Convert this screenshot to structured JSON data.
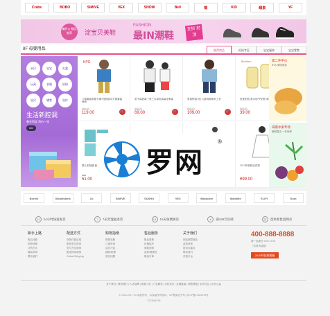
{
  "top_brands": [
    "Crabs",
    "BOBO",
    "SIMIVE",
    "VEX",
    "SHOW",
    "Bell",
    "帮",
    "KID",
    "晴泉",
    "YF"
  ],
  "banner": {
    "circle_text": "美的公\n精品推荐",
    "brand": "淀宝贝美鞋",
    "fashion": "FASHION",
    "main": "最IN潮鞋",
    "tag": "五折\n封顶"
  },
  "floor": {
    "title": "8F 母婴用品",
    "tabs": [
      "推荐商品",
      "妈妈专区",
      "宝宝服饰",
      "宝宝零食"
    ],
    "left_tags": [
      "米贝",
      "宝宝",
      "礼盒",
      "玩具",
      "衣服",
      "奶粉",
      "宝贝",
      "辅食",
      "洗护"
    ],
    "left_title": "生活新腔调",
    "left_sub": "春天特卖 特价一览",
    "left_btn": "GO",
    "products": [
      {
        "name": "儿童套装男童卡通T恤短袖中大童套装休闲",
        "old": "¥99.00",
        "price": "119.00"
      },
      {
        "name": "亲子装夏装一家三口母女装装全家装",
        "old": "¥99.00",
        "price": "69.00"
      },
      {
        "name": "男童短袖T恤 儿童纯棉休闲上衣",
        "old": "¥99.00",
        "price": "109.00"
      },
      {
        "name": "宝宝奶瓶 宽口径PP奶瓶 婴儿防胀气",
        "old": "¥99.00",
        "price": "39.00"
      },
      {
        "name": "婴儿奶粉罐 营养米粉",
        "old": "¥70",
        "price": "51.00"
      },
      {
        "name": "",
        "old": "",
        "price": ""
      },
      {
        "name": "",
        "old": "",
        "price": ""
      },
      {
        "name": "2013年新款连衣裙",
        "old": "",
        "price": "¥99.00"
      }
    ],
    "right_top_title": "第二件半价",
    "right_top_sub": "BVS 美味面包",
    "right_bot_title": "海南水果专场",
    "right_bot_sub": "新鲜直达 一件包邮"
  },
  "brand_row": [
    "Bornix",
    "Oikaimdans",
    "Zo",
    "SIMIVE",
    "SUSHO",
    "VEX",
    "Babycare",
    "MamiMe",
    "ELEY",
    "Gout"
  ],
  "services": [
    {
      "icon": "24",
      "label": "24小时快速发货"
    },
    {
      "icon": "7",
      "label": "7天无理由退货"
    },
    {
      "icon": "15",
      "label": "15天免费换货"
    },
    {
      "icon": "¥",
      "label": "满199元包邮"
    },
    {
      "icon": "店",
      "label": "百余家售后网点"
    }
  ],
  "help": [
    {
      "title": "新手上路",
      "items": [
        "售后流程",
        "购物流程",
        "订购方式",
        "隐私声明",
        "联系我们"
      ]
    },
    {
      "title": "配送方式",
      "items": [
        "货到付款区域",
        "配送支付查询",
        "支付方式说明",
        "配送时间说明",
        "Global Shipping"
      ]
    },
    {
      "title": "购物指南",
      "items": [
        "购物流程",
        "订单查询",
        "会员介绍",
        "团购/机票",
        "常见问题"
      ]
    },
    {
      "title": "售后服务",
      "items": [
        "售后政策",
        "价格保护",
        "退款说明",
        "返修/退换货",
        "取消订单"
      ]
    },
    {
      "title": "关于我们",
      "items": [
        "网站故障报告",
        "选机咨询",
        "投诉与建议",
        "联系我们",
        "开放平台"
      ]
    }
  ],
  "contact": {
    "tel": "400-888-8888",
    "hours": "周一至周日 9:00-17:00",
    "hours2": "（仅收市话费）",
    "btn": "24小时在线客服"
  },
  "footer": {
    "links": "关于我们 | 联系我们 | 人才招聘 | 商家入驻 | 广告服务 | 手机京东 | 友情链接 | 销售联盟 | 京东社区 | 京东公益",
    "copy": "© 2015-2017 XX 版权所有，并保留所有权利。ICP备案证书号: 京ICP备12345678号",
    "img": "7373596796"
  },
  "watermark": {
    "text": "罗网",
    "reg": "®"
  }
}
